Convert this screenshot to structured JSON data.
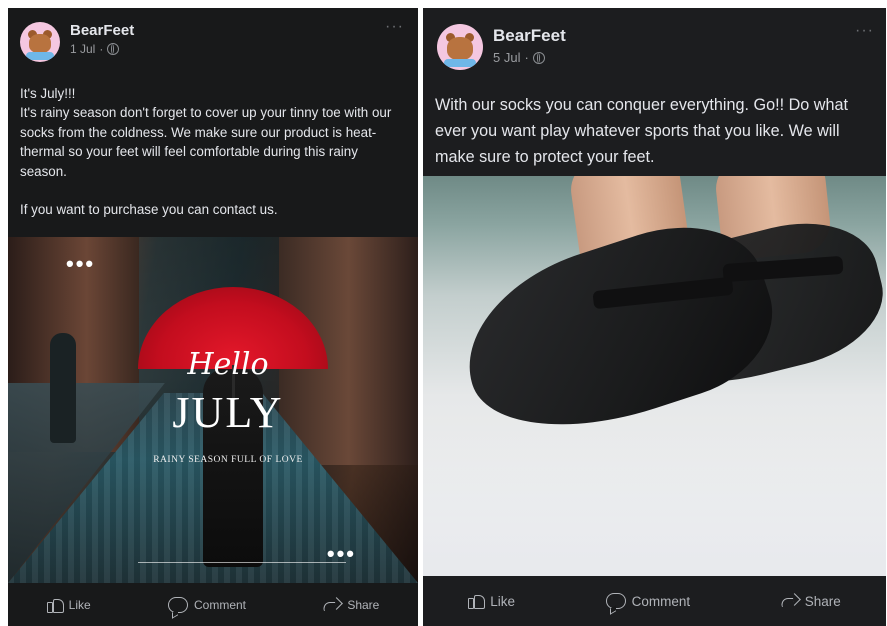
{
  "posts": [
    {
      "author": "BearFeet",
      "date": "1 Jul",
      "more": "···",
      "text": "It's July!!!\nIt's rainy season don't forget to cover up your tinny toe with our socks from the coldness. We make sure our product is heat-thermal so your feet will feel comfortable during this rainy season.\n\nIf you want to purchase you can contact us.",
      "image": {
        "hello": "Hello",
        "title": "JULY",
        "subtitle": "RAINY SEASON FULL OF LOVE",
        "dots": "•••"
      },
      "actions": {
        "like": "Like",
        "comment": "Comment",
        "share": "Share"
      }
    },
    {
      "author": "BearFeet",
      "date": "5 Jul",
      "more": "···",
      "text": "With our socks you can conquer everything. Go!! Do what ever you want play whatever sports that you like. We will make sure to protect your feet.",
      "actions": {
        "like": "Like",
        "comment": "Comment",
        "share": "Share"
      }
    }
  ],
  "icons": {
    "avatar": "bear-avatar-icon",
    "privacy": "globe-icon",
    "like": "thumbs-up-icon",
    "comment": "comment-bubble-icon",
    "share": "share-arrow-icon"
  },
  "colors": {
    "background": "#18191a",
    "text": "#e4e6eb",
    "muted": "#b0b3b8",
    "umbrella": "#d4121f",
    "avatar_bg": "#f4c7e0"
  }
}
